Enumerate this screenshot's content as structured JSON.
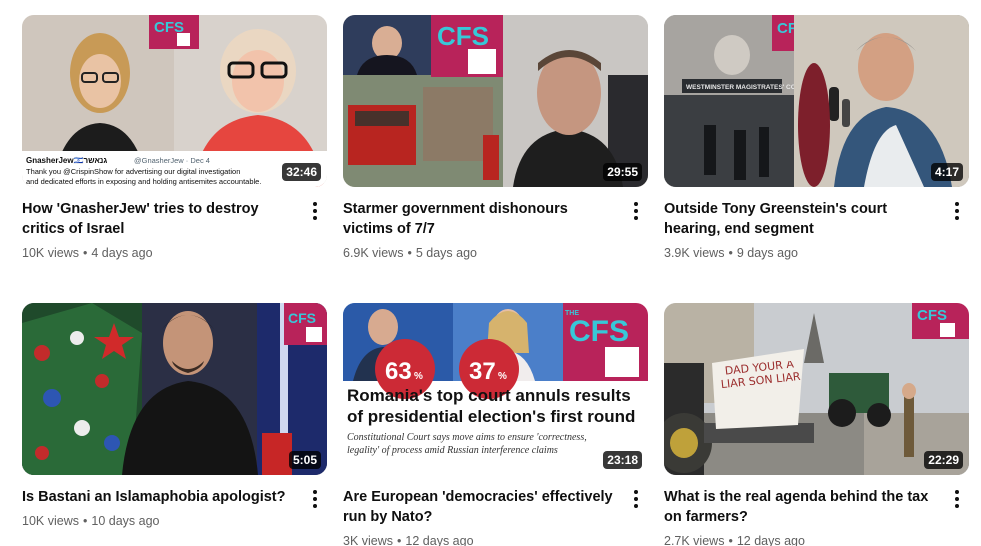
{
  "videos": [
    {
      "title": "How 'GnasherJew' tries to destroy critics of Israel",
      "views": "10K views",
      "age": "4 days ago",
      "duration": "32:46",
      "badge": "CFS",
      "caption": {
        "handle": "GnasherJew🇮🇱גנאשר",
        "account": "@GnasherJew · Dec 4",
        "line1": "Thank you @CrispinShow for advertising our digital investigation",
        "line2": "and dedicated efforts in exposing and holding antisemites accountable."
      }
    },
    {
      "title": "Starmer government dishonours victims of 7/7",
      "views": "6.9K views",
      "age": "5 days ago",
      "duration": "29:55",
      "badge": "CFS"
    },
    {
      "title": "Outside Tony Greenstein's court hearing, end segment",
      "views": "3.9K views",
      "age": "9 days ago",
      "duration": "4:17",
      "badge": "CFS",
      "sign": "WESTMINSTER MAGISTRATES' COURT"
    },
    {
      "title": "Is Bastani an Islamaphobia apologist?",
      "views": "10K views",
      "age": "10 days ago",
      "duration": "5:05",
      "badge": "CFS"
    },
    {
      "title": "Are European 'democracies' effectively run by Nato?",
      "views": "3K views",
      "age": "12 days ago",
      "duration": "23:18",
      "badge": "CFS",
      "badge_prefix": "THE",
      "pct1": "63",
      "pct2": "37",
      "pct_sign": "%",
      "headline": "Romania's top court annuls results of presidential election's first round",
      "subline": "Constitutional Court says move aims to ensure 'correctness, legality' of process amid Russian interference claims"
    },
    {
      "title": "What is the real agenda behind the tax on farmers?",
      "views": "2.7K views",
      "age": "12 days ago",
      "duration": "22:29",
      "badge": "CFS",
      "banner": "DAD YOUR A LIAR SON LIAR"
    }
  ],
  "separator": "•",
  "colors": {
    "badge": "#b8235a",
    "badge_text": "#37c8d8",
    "duration_bg": "#000000",
    "meta_text": "#606060"
  }
}
